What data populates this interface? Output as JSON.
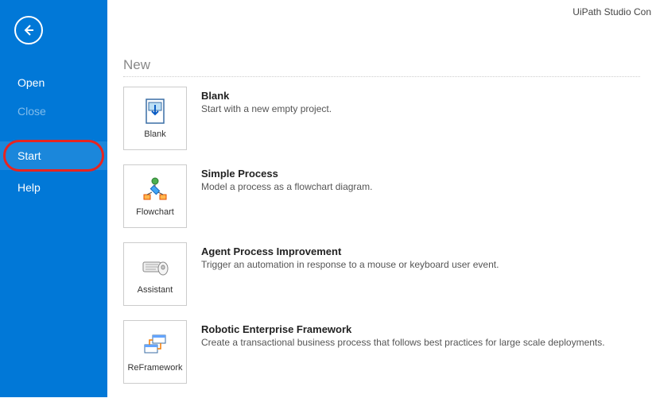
{
  "app_title": "UiPath Studio Con",
  "sidebar": {
    "items": [
      {
        "label": "Open",
        "disabled": false,
        "selected": false
      },
      {
        "label": "Close",
        "disabled": true,
        "selected": false
      },
      {
        "label": "Start",
        "disabled": false,
        "selected": true,
        "highlight": true
      },
      {
        "label": "Help",
        "disabled": false,
        "selected": false
      }
    ]
  },
  "main": {
    "heading": "New",
    "templates": [
      {
        "tile_label": "Blank",
        "title": "Blank",
        "description": "Start with a new empty project.",
        "icon": "blank-icon"
      },
      {
        "tile_label": "Flowchart",
        "title": "Simple Process",
        "description": "Model a process as a flowchart diagram.",
        "icon": "flowchart-icon"
      },
      {
        "tile_label": "Assistant",
        "title": "Agent Process Improvement",
        "description": "Trigger an automation in response to a mouse or keyboard user event.",
        "icon": "assistant-icon"
      },
      {
        "tile_label": "ReFramework",
        "title": "Robotic Enterprise Framework",
        "description": "Create a transactional business process that follows best practices for large scale deployments.",
        "icon": "reframework-icon"
      }
    ]
  }
}
